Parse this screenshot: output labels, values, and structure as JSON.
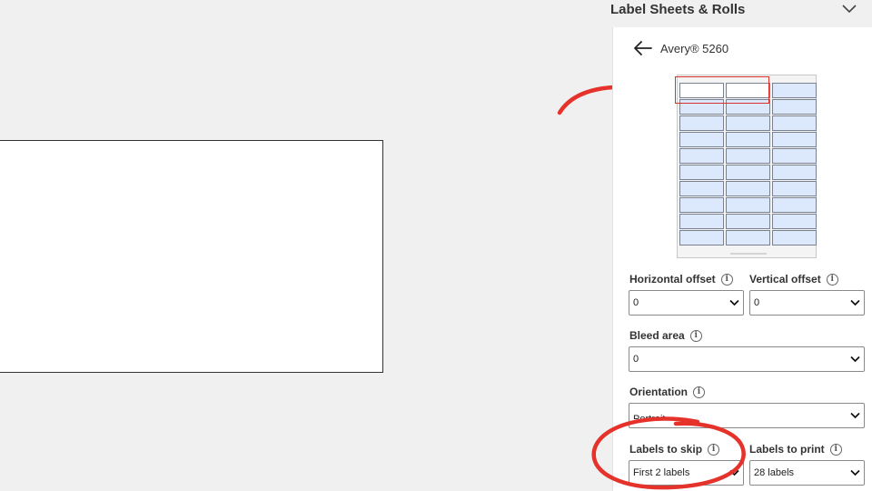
{
  "panel": {
    "title": "Label Sheets & Rolls",
    "collapse_icon": "chevron-up-icon"
  },
  "template": {
    "back_icon": "arrow-left-icon",
    "name": "Avery® 5260"
  },
  "sheet": {
    "columns": 3,
    "rows": 10,
    "skipped_count": 2
  },
  "fields": {
    "horizontal_offset": {
      "label": "Horizontal offset",
      "value": "0"
    },
    "vertical_offset": {
      "label": "Vertical offset",
      "value": "0"
    },
    "bleed_area": {
      "label": "Bleed area",
      "value": "0"
    },
    "orientation": {
      "label": "Orientation",
      "value": "Portrait"
    },
    "labels_to_skip": {
      "label": "Labels to skip",
      "value": "First 2 labels"
    },
    "labels_to_print": {
      "label": "Labels to print",
      "value": "28 labels"
    }
  },
  "icons": {
    "info": "info-icon",
    "dropdown": "chevron-down-icon"
  },
  "colors": {
    "annotation": "#e5322b",
    "label_fill": "#dce8fb"
  }
}
